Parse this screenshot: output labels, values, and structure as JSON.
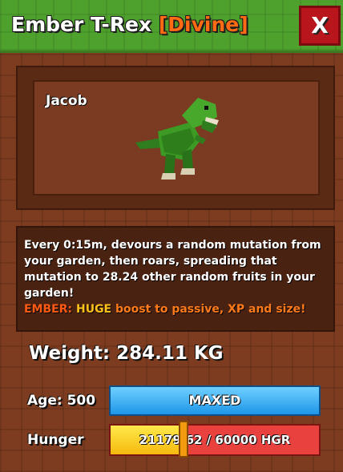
{
  "header": {
    "pet_name": "Ember T-Rex",
    "rarity": "[Divine]",
    "rarity_color": "#ff6a14",
    "close_label": "X"
  },
  "viewport": {
    "nickname": "Jacob"
  },
  "description": {
    "text": "Every 0:15m, devours a random mutation from your garden, then roars, spreading that mutation to 28.24 other random fruits in your garden!",
    "mutation_name": "EMBER:",
    "mutation_huge": "HUGE",
    "mutation_rest": "boost to passive, XP and size!"
  },
  "stats": {
    "weight": "Weight: 284.11 KG",
    "age_label": "Age: 500",
    "age_bar": "MAXED",
    "hunger_label": "Hunger",
    "hunger_text": "21179.62 / 60000 HGR",
    "hunger_value": 21179.62,
    "hunger_max": 60000
  }
}
